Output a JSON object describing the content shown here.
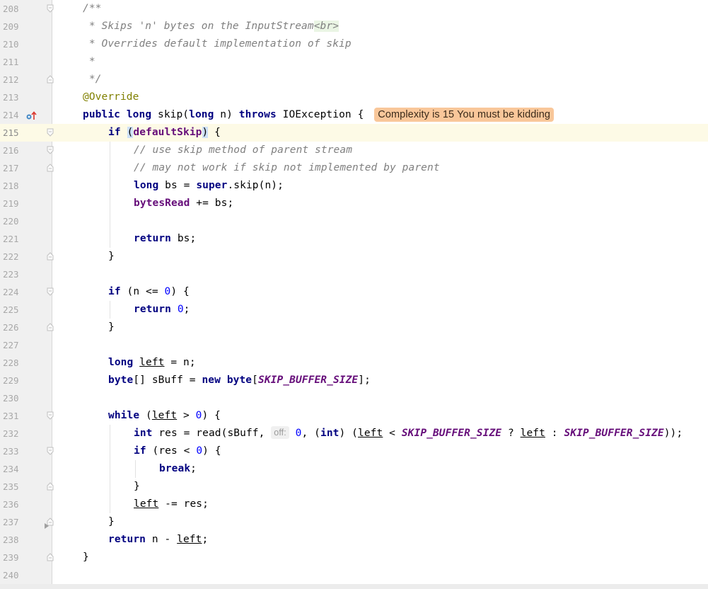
{
  "editor": {
    "complexity_badge": "Complexity is 15 You must be kidding",
    "param_hint": "off:",
    "lines": [
      {
        "n": "208"
      },
      {
        "n": "209"
      },
      {
        "n": "210"
      },
      {
        "n": "211"
      },
      {
        "n": "212"
      },
      {
        "n": "213"
      },
      {
        "n": "214"
      },
      {
        "n": "215"
      },
      {
        "n": "216"
      },
      {
        "n": "217"
      },
      {
        "n": "218"
      },
      {
        "n": "219"
      },
      {
        "n": "220"
      },
      {
        "n": "221"
      },
      {
        "n": "222"
      },
      {
        "n": "223"
      },
      {
        "n": "224"
      },
      {
        "n": "225"
      },
      {
        "n": "226"
      },
      {
        "n": "227"
      },
      {
        "n": "228"
      },
      {
        "n": "229"
      },
      {
        "n": "230"
      },
      {
        "n": "231"
      },
      {
        "n": "232"
      },
      {
        "n": "233"
      },
      {
        "n": "234"
      },
      {
        "n": "235"
      },
      {
        "n": "236"
      },
      {
        "n": "237"
      },
      {
        "n": "238"
      },
      {
        "n": "239"
      },
      {
        "n": "240"
      }
    ],
    "code": {
      "l208": "/**",
      "l209a": " * Skips 'n' bytes on the InputStream",
      "l209b": "<br>",
      "l210": " * Overrides default implementation of skip",
      "l211": " *",
      "l212": " */",
      "l213": "@Override",
      "l214_public": "public",
      "l214_long": "long",
      "l214_a": " skip(",
      "l214_long2": "long",
      "l214_b": " n) ",
      "l214_throws": "throws",
      "l214_c": " IOException {",
      "l215_if": "if",
      "l215_open": "(",
      "l215_field": "defaultSkip",
      "l215_close": ")",
      "l215_end": " {",
      "l216": "// use skip method of parent stream",
      "l217": "// may not work if skip not implemented by parent",
      "l218_long": "long",
      "l218_a": " bs = ",
      "l218_super": "super",
      "l218_b": ".skip(n);",
      "l219_field": "bytesRead",
      "l219_a": " += bs;",
      "l221_return": "return",
      "l221_a": " bs;",
      "l222": "}",
      "l224_if": "if",
      "l224_a": " (n <= ",
      "l224_num": "0",
      "l224_b": ") {",
      "l225_return": "return",
      "l225_num": "0",
      "l225_a": ";",
      "l226": "}",
      "l228_long": "long",
      "l228_var": "left",
      "l228_a": " = n;",
      "l229_byte": "byte",
      "l229_a": "[] sBuff = ",
      "l229_new": "new",
      "l229_byte2": "byte",
      "l229_b": "[",
      "l229_const": "SKIP_BUFFER_SIZE",
      "l229_c": "];",
      "l231_while": "while",
      "l231_a": " (",
      "l231_var": "left",
      "l231_b": " > ",
      "l231_num": "0",
      "l231_c": ") {",
      "l232_int": "int",
      "l232_a": " res = read(sBuff, ",
      "l232_num": "0",
      "l232_b": ", (",
      "l232_int2": "int",
      "l232_c": ") (",
      "l232_var1": "left",
      "l232_d": " < ",
      "l232_const1": "SKIP_BUFFER_SIZE",
      "l232_e": " ? ",
      "l232_var2": "left",
      "l232_f": " : ",
      "l232_const2": "SKIP_BUFFER_SIZE",
      "l232_g": "));",
      "l233_if": "if",
      "l233_a": " (res < ",
      "l233_num": "0",
      "l233_b": ") {",
      "l234_break": "break",
      "l234_a": ";",
      "l235": "}",
      "l236_var": "left",
      "l236_a": " -= res;",
      "l237": "}",
      "l238_return": "return",
      "l238_a": " n - ",
      "l238_var": "left",
      "l238_b": ";",
      "l239": "}"
    }
  },
  "colors": {
    "keyword": "#000080",
    "comment": "#808080",
    "annotation": "#808000",
    "number": "#0000ff",
    "field": "#660e7a",
    "badge_bg": "#f9c79a",
    "current_line": "#fdfae6"
  },
  "icons": {
    "gutter_override": "override-method-icon",
    "fold": "fold-marker-icon"
  }
}
